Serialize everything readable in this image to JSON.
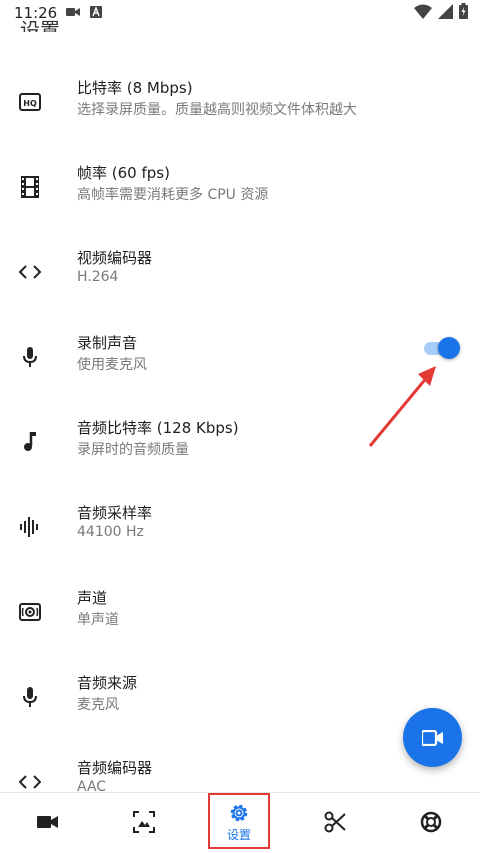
{
  "status_bar": {
    "time": "11:26"
  },
  "page": {
    "title": "设置"
  },
  "settings": [
    {
      "title": "比特率 (8 Mbps)",
      "subtitle": "选择录屏质量。质量越高则视频文件体积越大",
      "icon": "hq-icon"
    },
    {
      "title": "帧率 (60 fps)",
      "subtitle": "高帧率需要消耗更多 CPU 资源",
      "icon": "film-icon"
    },
    {
      "title": "视频编码器",
      "subtitle": "H.264",
      "icon": "code-icon"
    },
    {
      "title": "录制声音",
      "subtitle": "使用麦克风",
      "icon": "mic-icon",
      "toggle_on": true
    },
    {
      "title": "音频比特率 (128 Kbps)",
      "subtitle": "录屏时的音频质量",
      "icon": "music-note-icon"
    },
    {
      "title": "音频采样率",
      "subtitle": "44100 Hz",
      "icon": "waveform-icon"
    },
    {
      "title": "声道",
      "subtitle": "单声道",
      "icon": "speaker-icon"
    },
    {
      "title": "音频来源",
      "subtitle": "麦克风",
      "icon": "mic-icon"
    },
    {
      "title": "音频编码器",
      "subtitle": "AAC",
      "icon": "code-icon"
    }
  ],
  "bottom_nav": {
    "items": [
      {
        "name": "videos",
        "icon": "video-camera-icon"
      },
      {
        "name": "screenshots",
        "icon": "image-icon"
      },
      {
        "name": "settings",
        "icon": "gear-icon",
        "label": "设置",
        "active": true
      },
      {
        "name": "tools",
        "icon": "scissors-icon"
      },
      {
        "name": "help",
        "icon": "lifebuoy-icon"
      }
    ]
  },
  "colors": {
    "accent": "#1a73e8",
    "annotation": "#e53935"
  }
}
